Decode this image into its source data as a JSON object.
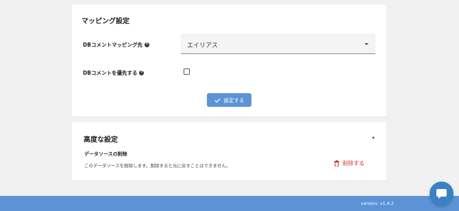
{
  "mapping_card": {
    "title": "マッピング設定",
    "db_comment_mapping_label": "DBコメントマッピング先",
    "select_value": "エイリアス",
    "db_comment_priority_label": "DBコメントを優先する",
    "submit_label": "設定する"
  },
  "advanced_card": {
    "title": "高度な設定",
    "delete_section_title": "データソースの削除",
    "delete_description": "このデータソースを削除します。削除すると元に戻すことはできません。",
    "delete_label": "削除する"
  },
  "footer": {
    "version": "version: v1.4.2"
  },
  "icons": {
    "help": "help-icon",
    "dropdown": "chevron-down-icon",
    "check": "check-icon",
    "collapse": "chevron-up-icon",
    "trash": "trash-icon",
    "chat": "chat-icon"
  },
  "colors": {
    "primary": "#5b93d6",
    "danger": "#d0312d",
    "chat": "#3b82c4",
    "background": "#f1f1f1"
  }
}
